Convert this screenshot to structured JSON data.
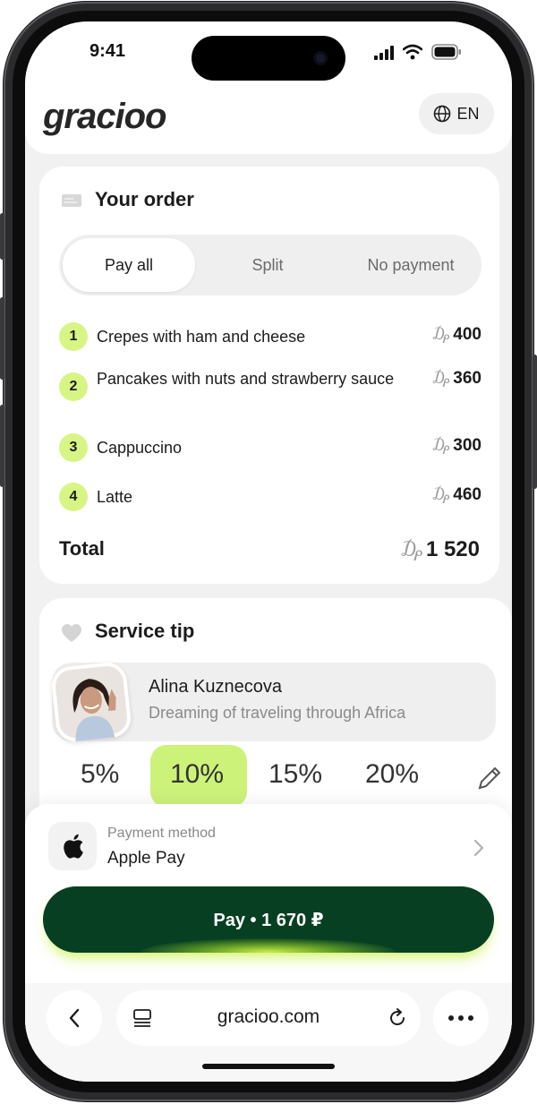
{
  "status_bar": {
    "time": "9:41"
  },
  "header": {
    "logo": "gracioo",
    "language": "EN"
  },
  "order": {
    "title": "Your order",
    "tabs": [
      "Pay all",
      "Split",
      "No payment"
    ],
    "active_tab": "Pay all",
    "currency_symbol": "₯",
    "items": [
      {
        "number": "1",
        "name": "Crepes with ham and cheese",
        "price": "400"
      },
      {
        "number": "2",
        "name": "Pancakes with nuts and strawberry sauce",
        "price": "360"
      },
      {
        "number": "3",
        "name": "Cappuccino",
        "price": "300"
      },
      {
        "number": "4",
        "name": "Latte",
        "price": "460"
      }
    ],
    "total_label": "Total",
    "total_value": "1 520"
  },
  "tip": {
    "title": "Service tip",
    "waiter_name": "Alina Kuznecova",
    "waiter_status": "Dreaming of traveling through Africa",
    "options": [
      "5%",
      "10%",
      "15%",
      "20%"
    ],
    "selected": "10%"
  },
  "payment": {
    "method_label": "Payment method",
    "method_value": "Apple Pay",
    "pay_button": "Pay • 1 670 ₽"
  },
  "browser": {
    "url": "gracioo.com"
  },
  "colors": {
    "accent_green": "#d7f585",
    "pay_button": "#063f22",
    "glow": "#c4f03c"
  }
}
